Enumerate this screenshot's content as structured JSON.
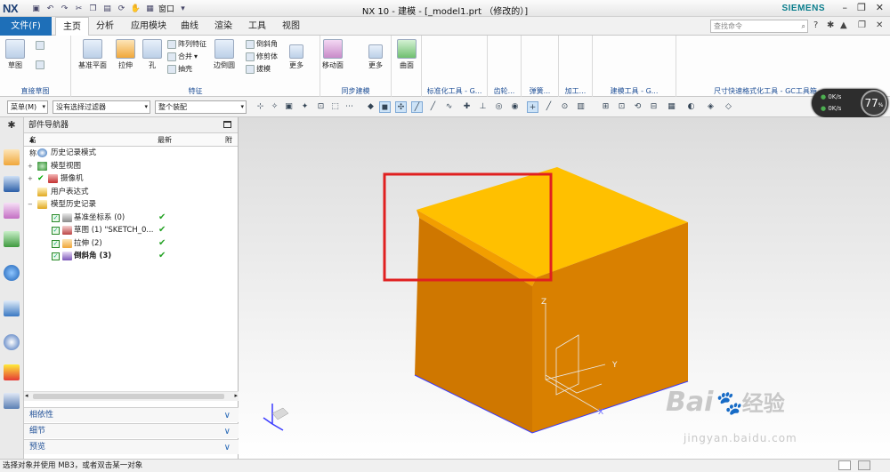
{
  "app": {
    "logo": "NX",
    "title": "NX 10 - 建模 - [_model1.prt （修改的）]",
    "brand": "SIEMENS",
    "window_menu": "窗口",
    "search_placeholder": "查找命令"
  },
  "ribbon_tabs": [
    "文件(F)",
    "主页",
    "分析",
    "应用模块",
    "曲线",
    "渲染",
    "工具",
    "视图"
  ],
  "ribbon": {
    "direct_sketch": {
      "sketch": "草图",
      "group": "直接草图"
    },
    "feature": {
      "datum_plane": "基准平面",
      "extrude": "拉伸",
      "hole": "孔",
      "pattern": "阵列特征",
      "unite": "合并",
      "shell": "抽壳",
      "edge_blend": "边倒圆",
      "chamfer": "倒斜角",
      "trim_body": "修剪体",
      "draft": "拔模",
      "more": "更多",
      "group": "特征"
    },
    "sync": {
      "move_face": "移动面",
      "more": "更多",
      "group": "同步建模"
    },
    "surface": {
      "label": "曲面"
    },
    "groups_tail": [
      "标准化工具 - G...",
      "齿轮...",
      "弹簧...",
      "加工...",
      "建模工具 - G...",
      "尺寸快速格式化工具 - GC工具箱"
    ]
  },
  "toolbar2": {
    "menu": "菜单(M)",
    "filter": "没有选择过滤器",
    "scope": "整个装配"
  },
  "navigator": {
    "title": "部件导航器",
    "col_name": "名称",
    "col_latest": "最新",
    "col_extra": "附",
    "rows": [
      {
        "label": "历史记录模式",
        "latest": ""
      },
      {
        "label": "模型视图",
        "latest": ""
      },
      {
        "label": "摄像机",
        "latest": ""
      },
      {
        "label": "用户表达式",
        "latest": ""
      },
      {
        "label": "模型历史记录",
        "latest": ""
      },
      {
        "label": "基准坐标系 (0)",
        "latest": "✔"
      },
      {
        "label": "草图 (1) \"SKETCH_0...",
        "latest": "✔"
      },
      {
        "label": "拉伸 (2)",
        "latest": "✔"
      },
      {
        "label": "倒斜角 (3)",
        "latest": "✔"
      }
    ],
    "panels": [
      "相依性",
      "细节",
      "预览"
    ]
  },
  "gauge": {
    "percent": "77",
    "pct_sign": "%",
    "up": "0K/s",
    "down": "0K/s"
  },
  "status": {
    "text": "选择对象并使用 MB3，或者双击某一对象"
  },
  "watermark": {
    "brand": "Bai",
    "brand2": "经验",
    "url": "jingyan.baidu.com"
  },
  "colors": {
    "cube_top": "#FFC000",
    "cube_front": "#E08000",
    "cube_side": "#C96F00",
    "highlight_box": "#E02020",
    "accent": "#1E6FB8"
  }
}
